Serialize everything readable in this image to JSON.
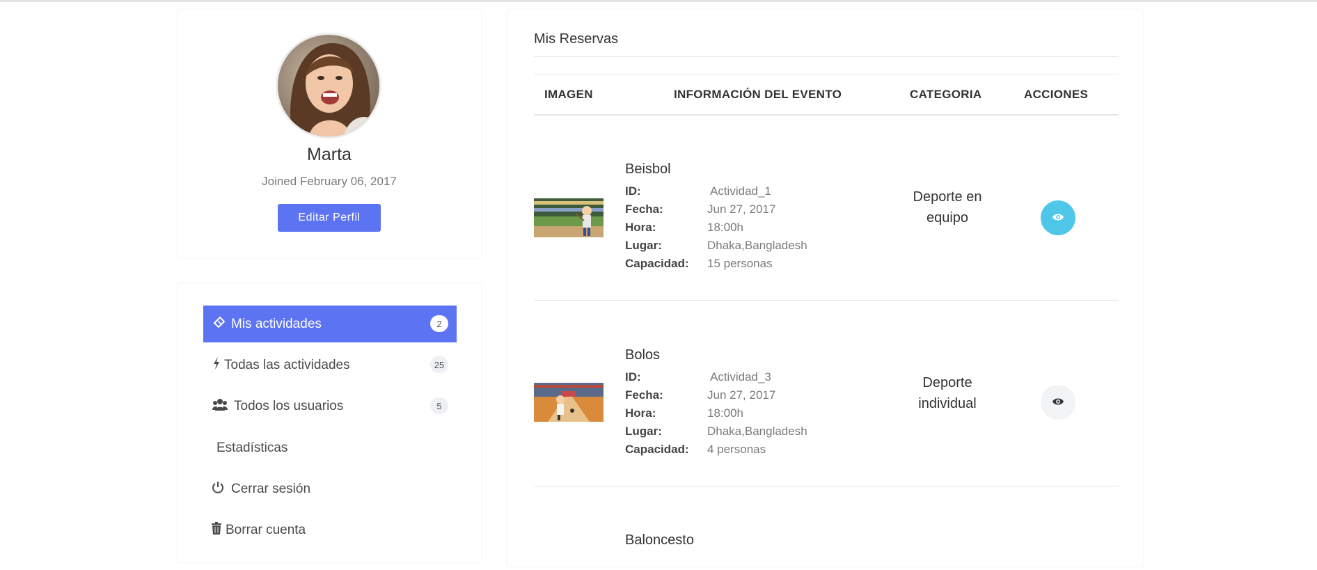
{
  "profile": {
    "name": "Marta",
    "joined": "Joined February 06, 2017",
    "edit_label": "Editar Perfil"
  },
  "menu": {
    "items": [
      {
        "label": "Mis actividades",
        "badge": "2",
        "icon": "ticket-icon"
      },
      {
        "label": "Todas las actividades",
        "badge": "25",
        "icon": "bolt-icon"
      },
      {
        "label": "Todos los usuarios",
        "badge": "5",
        "icon": "users-icon"
      },
      {
        "label": "Estadísticas"
      },
      {
        "label": "Cerrar sesión",
        "icon": "power-icon"
      },
      {
        "label": "Borrar cuenta",
        "icon": "trash-icon"
      }
    ]
  },
  "reservations": {
    "title": "Mis Reservas",
    "headers": [
      "IMAGEN",
      "INFORMACIÓN DEL EVENTO",
      "CATEGORIA",
      "ACCIONES"
    ],
    "field_labels": {
      "id": "ID:",
      "fecha": "Fecha:",
      "hora": "Hora:",
      "lugar": "Lugar:",
      "capacidad": "Capacidad:"
    },
    "rows": [
      {
        "title": "Beisbol",
        "id": "Actividad_1",
        "fecha": "Jun 27, 2017",
        "hora": "18:00h",
        "lugar": "Dhaka,Bangladesh",
        "capacidad": "15 personas",
        "categoria_line1": "Deporte en",
        "categoria_line2": "equipo"
      },
      {
        "title": "Bolos",
        "id": "Actividad_3",
        "fecha": "Jun 27, 2017",
        "hora": "18:00h",
        "lugar": "Dhaka,Bangladesh",
        "capacidad": "4 personas",
        "categoria_line1": "Deporte",
        "categoria_line2": "individual"
      },
      {
        "title": "Baloncesto"
      }
    ]
  },
  "colors": {
    "primary": "#5c73f2",
    "info": "#4fc7e8"
  }
}
